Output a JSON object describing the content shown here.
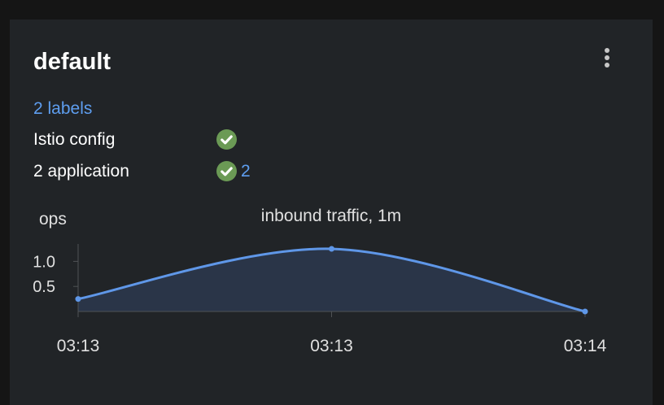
{
  "card": {
    "title": "default",
    "labels_link": "2 labels",
    "istio_config_label": "Istio config",
    "istio_status": "check-circle-icon",
    "apps_label": "2 application",
    "apps_status": "check-circle-icon",
    "apps_count": "2"
  },
  "colors": {
    "background": "#151515",
    "card": "#212427",
    "link": "#5e9ef0",
    "success": "#6b9a55",
    "line": "#5f97e8",
    "area": "#2a3548"
  },
  "chart_data": {
    "type": "area",
    "title": "inbound traffic, 1m",
    "ylabel": "ops",
    "x": [
      "03:13",
      "03:13",
      "03:14"
    ],
    "values": [
      0.25,
      1.25,
      0.0
    ],
    "y_ticks": [
      "0.5",
      "1.0"
    ],
    "ylim": [
      0,
      1.25
    ],
    "grid": false,
    "legend": "none"
  }
}
